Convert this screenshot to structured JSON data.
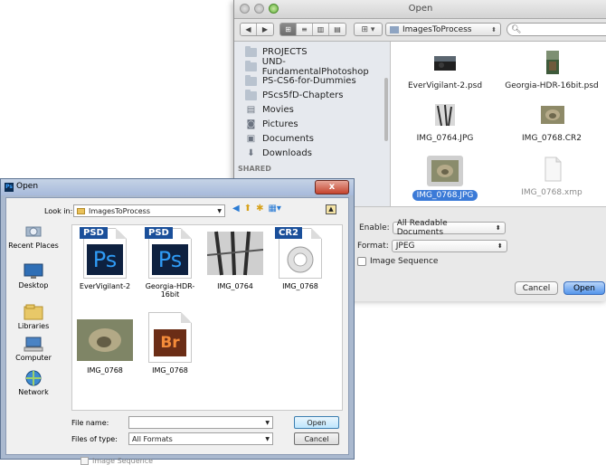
{
  "mac_dialog": {
    "title": "Open",
    "toolbar": {
      "view_icons": [
        "icon-view-icon",
        "list-view-icon",
        "column-view-icon",
        "coverflow-view-icon"
      ],
      "arrange": "arrange-menu",
      "location": "ImagesToProcess",
      "search_placeholder": ""
    },
    "sidebar": {
      "items": [
        {
          "label": "PROJECTS",
          "icon": "folder"
        },
        {
          "label": "UND-FundamentalPhotoshop",
          "icon": "folder"
        },
        {
          "label": "PS-CS6-for-Dummies",
          "icon": "folder"
        },
        {
          "label": "PScs5fD-Chapters",
          "icon": "folder"
        },
        {
          "label": "Movies",
          "icon": "movies"
        },
        {
          "label": "Pictures",
          "icon": "camera"
        },
        {
          "label": "Documents",
          "icon": "documents"
        },
        {
          "label": "Downloads",
          "icon": "downloads"
        }
      ],
      "shared_header": "SHARED"
    },
    "files": [
      {
        "name": "EverVigilant-2.psd",
        "selected": false,
        "dim": false
      },
      {
        "name": "Georgia-HDR-16bit.psd",
        "selected": false,
        "dim": false
      },
      {
        "name": "IMG_0764.JPG",
        "selected": false,
        "dim": false
      },
      {
        "name": "IMG_0768.CR2",
        "selected": false,
        "dim": false
      },
      {
        "name": "IMG_0768.JPG",
        "selected": true,
        "dim": false
      },
      {
        "name": "IMG_0768.xmp",
        "selected": false,
        "dim": true
      }
    ],
    "enable_label": "Enable:",
    "enable_value": "All Readable Documents",
    "format_label": "Format:",
    "format_value": "JPEG",
    "image_sequence_label": "Image Sequence",
    "cancel_label": "Cancel",
    "open_label": "Open"
  },
  "win_dialog": {
    "title": "Open",
    "close_glyph": "x",
    "look_in_label": "Look in:",
    "look_in_value": "ImagesToProcess",
    "places": [
      {
        "label": "Recent Places"
      },
      {
        "label": "Desktop"
      },
      {
        "label": "Libraries"
      },
      {
        "label": "Computer"
      },
      {
        "label": "Network"
      }
    ],
    "files": [
      {
        "name": "EverVigilant-2",
        "tag": "PSD",
        "glyph": "Ps"
      },
      {
        "name": "Georgia-HDR-16bit",
        "tag": "PSD",
        "glyph": "Ps"
      },
      {
        "name": "IMG_0764"
      },
      {
        "name": "IMG_0768",
        "tag": "CR2"
      },
      {
        "name": "IMG_0768"
      },
      {
        "name": "IMG_0768",
        "glyph": "Br"
      }
    ],
    "file_name_label": "File name:",
    "file_name_value": "",
    "files_of_type_label": "Files of type:",
    "files_of_type_value": "All Formats",
    "open_label": "Open",
    "cancel_label": "Cancel",
    "image_sequence_label": "Image Sequence"
  }
}
